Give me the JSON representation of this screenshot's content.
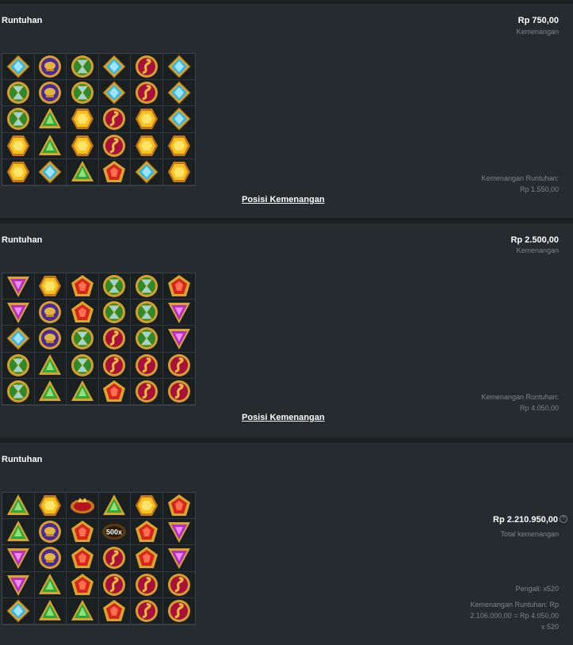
{
  "colors": {
    "background": "#1c2124",
    "panel": "#252b2f",
    "muted": "#7c858b"
  },
  "icon_legend": {
    "B": "blue-diamond-gem-icon",
    "C": "purple-scarab-coin-icon",
    "H": "green-hourglass-coin-icon",
    "S": "red-serpent-coin-icon",
    "G": "green-triangle-gem-icon",
    "Y": "yellow-hexagon-gem-icon",
    "R": "red-pentagon-gem-icon",
    "P": "purple-triangle-gem-icon",
    "W": "winged-crown-scatter-icon",
    "M": "multiplier-orb-icon"
  },
  "cascades": [
    {
      "label": "Runtuhan",
      "amount": "Rp 750,00",
      "amount_caption": "Kemenangan",
      "cascade_win_label": "Kemenangan Runtuhan:",
      "cascade_win_value": "Rp 1.550,00",
      "link": "Posisi Kemenangan",
      "grid": [
        [
          "B",
          "C",
          "H",
          "B",
          "S",
          "B"
        ],
        [
          "H",
          "C",
          "H",
          "B",
          "S",
          "B"
        ],
        [
          "H",
          "G",
          "Y",
          "S",
          "Y",
          "B"
        ],
        [
          "Y",
          "G",
          "Y",
          "S",
          "Y",
          "Y"
        ],
        [
          "Y",
          "B",
          "G",
          "R",
          "B",
          "Y"
        ]
      ]
    },
    {
      "label": "Runtuhan",
      "amount": "Rp 2.500,00",
      "amount_caption": "Kemenangan",
      "cascade_win_label": "Kemenangan Runtuhan:",
      "cascade_win_value": "Rp 4.050,00",
      "link": "Posisi Kemenangan",
      "grid": [
        [
          "P",
          "Y",
          "R",
          "H",
          "H",
          "R"
        ],
        [
          "P",
          "C",
          "R",
          "H",
          "H",
          "P"
        ],
        [
          "B",
          "C",
          "H",
          "S",
          "H",
          "P"
        ],
        [
          "H",
          "G",
          "H",
          "S",
          "S",
          "S"
        ],
        [
          "H",
          "G",
          "G",
          "R",
          "S",
          "S"
        ]
      ]
    },
    {
      "label": "Runtuhan",
      "amount": "Rp 2.210.950,00",
      "help_icon": "?",
      "amount_caption": "Total kemenangan",
      "multiplier_text": "Pengali: x520",
      "cascade_win_text": "Kemenangan Runtuhan: Rp 2.106.000,00 = Rp 4.050,00 x 520",
      "multiplier_orb_label": "500x",
      "grid": [
        [
          "G",
          "Y",
          "W",
          "G",
          "Y",
          "R"
        ],
        [
          "G",
          "C",
          "R",
          "M",
          "R",
          "P"
        ],
        [
          "P",
          "C",
          "R",
          "S",
          "R",
          "P"
        ],
        [
          "P",
          "G",
          "R",
          "S",
          "S",
          "S"
        ],
        [
          "B",
          "G",
          "G",
          "R",
          "S",
          "S"
        ]
      ]
    }
  ]
}
